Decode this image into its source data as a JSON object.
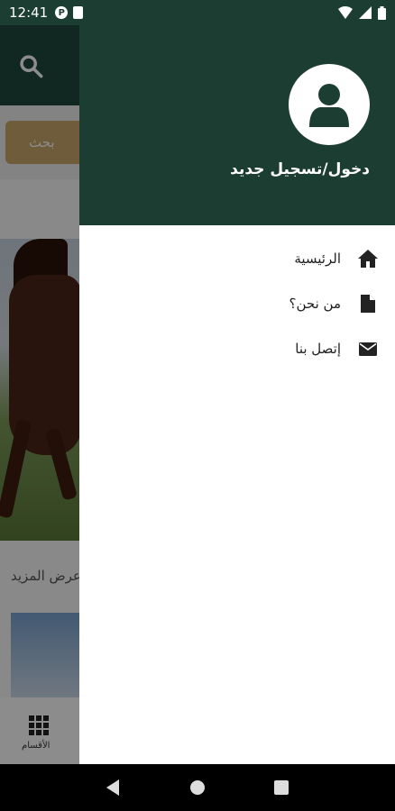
{
  "status_bar": {
    "time": "12:41",
    "left_icons": [
      "p-badge-icon",
      "sd-card-icon"
    ],
    "right_icons": [
      "wifi-icon",
      "signal-icon",
      "battery-icon"
    ]
  },
  "background": {
    "search_button": "بحث",
    "more_text": "عرض المزيد",
    "bottom_nav_label": "الأقسام"
  },
  "drawer": {
    "login_label": "دخول/تسجيل جديد",
    "items": [
      {
        "label": "الرئيسية",
        "icon": "home-icon"
      },
      {
        "label": "من نحن؟",
        "icon": "document-icon"
      },
      {
        "label": "إتصل بنا",
        "icon": "mail-icon"
      }
    ]
  },
  "colors": {
    "primary": "#1b3d32",
    "accent": "#c9a86a"
  }
}
